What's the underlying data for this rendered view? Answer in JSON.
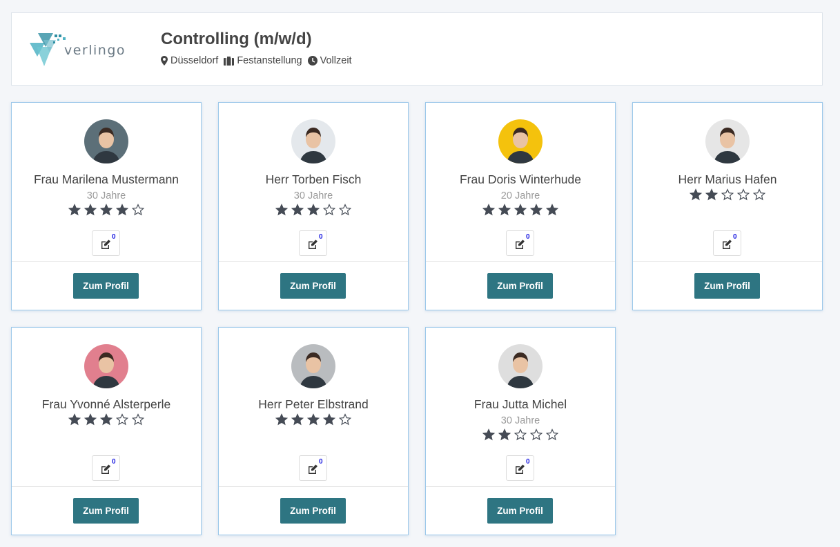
{
  "header": {
    "logo_text": "verlingo",
    "job_title": "Controlling (m/w/d)",
    "location": "Düsseldorf",
    "employment_type": "Festanstellung",
    "schedule": "Vollzeit"
  },
  "colors": {
    "accent": "#2e7582",
    "card_border": "#9cc8ea",
    "star": "#454b55",
    "badge": "#1a1ae0"
  },
  "candidates": [
    {
      "name": "Frau Marilena Mustermann",
      "age": "30 Jahre",
      "rating": 4,
      "notes": "0",
      "button": "Zum Profil",
      "avatar_bg": "#5c6f78"
    },
    {
      "name": "Herr Torben Fisch",
      "age": "30 Jahre",
      "rating": 3,
      "notes": "0",
      "button": "Zum Profil",
      "avatar_bg": "#e4e8ec"
    },
    {
      "name": "Frau Doris Winterhude",
      "age": "20 Jahre",
      "rating": 5,
      "notes": "0",
      "button": "Zum Profil",
      "avatar_bg": "#f4c20d"
    },
    {
      "name": "Herr Marius Hafen",
      "age": "",
      "rating": 2,
      "notes": "0",
      "button": "Zum Profil",
      "avatar_bg": "#e6e6e6"
    },
    {
      "name": "Frau Yvonné Alsterperle",
      "age": "",
      "rating": 3,
      "notes": "0",
      "button": "Zum Profil",
      "avatar_bg": "#e17f8e"
    },
    {
      "name": "Herr Peter Elbstrand",
      "age": "",
      "rating": 4,
      "notes": "0",
      "button": "Zum Profil",
      "avatar_bg": "#b9bcbf"
    },
    {
      "name": "Frau Jutta Michel",
      "age": "30 Jahre",
      "rating": 2,
      "notes": "0",
      "button": "Zum Profil",
      "avatar_bg": "#dedede"
    }
  ]
}
